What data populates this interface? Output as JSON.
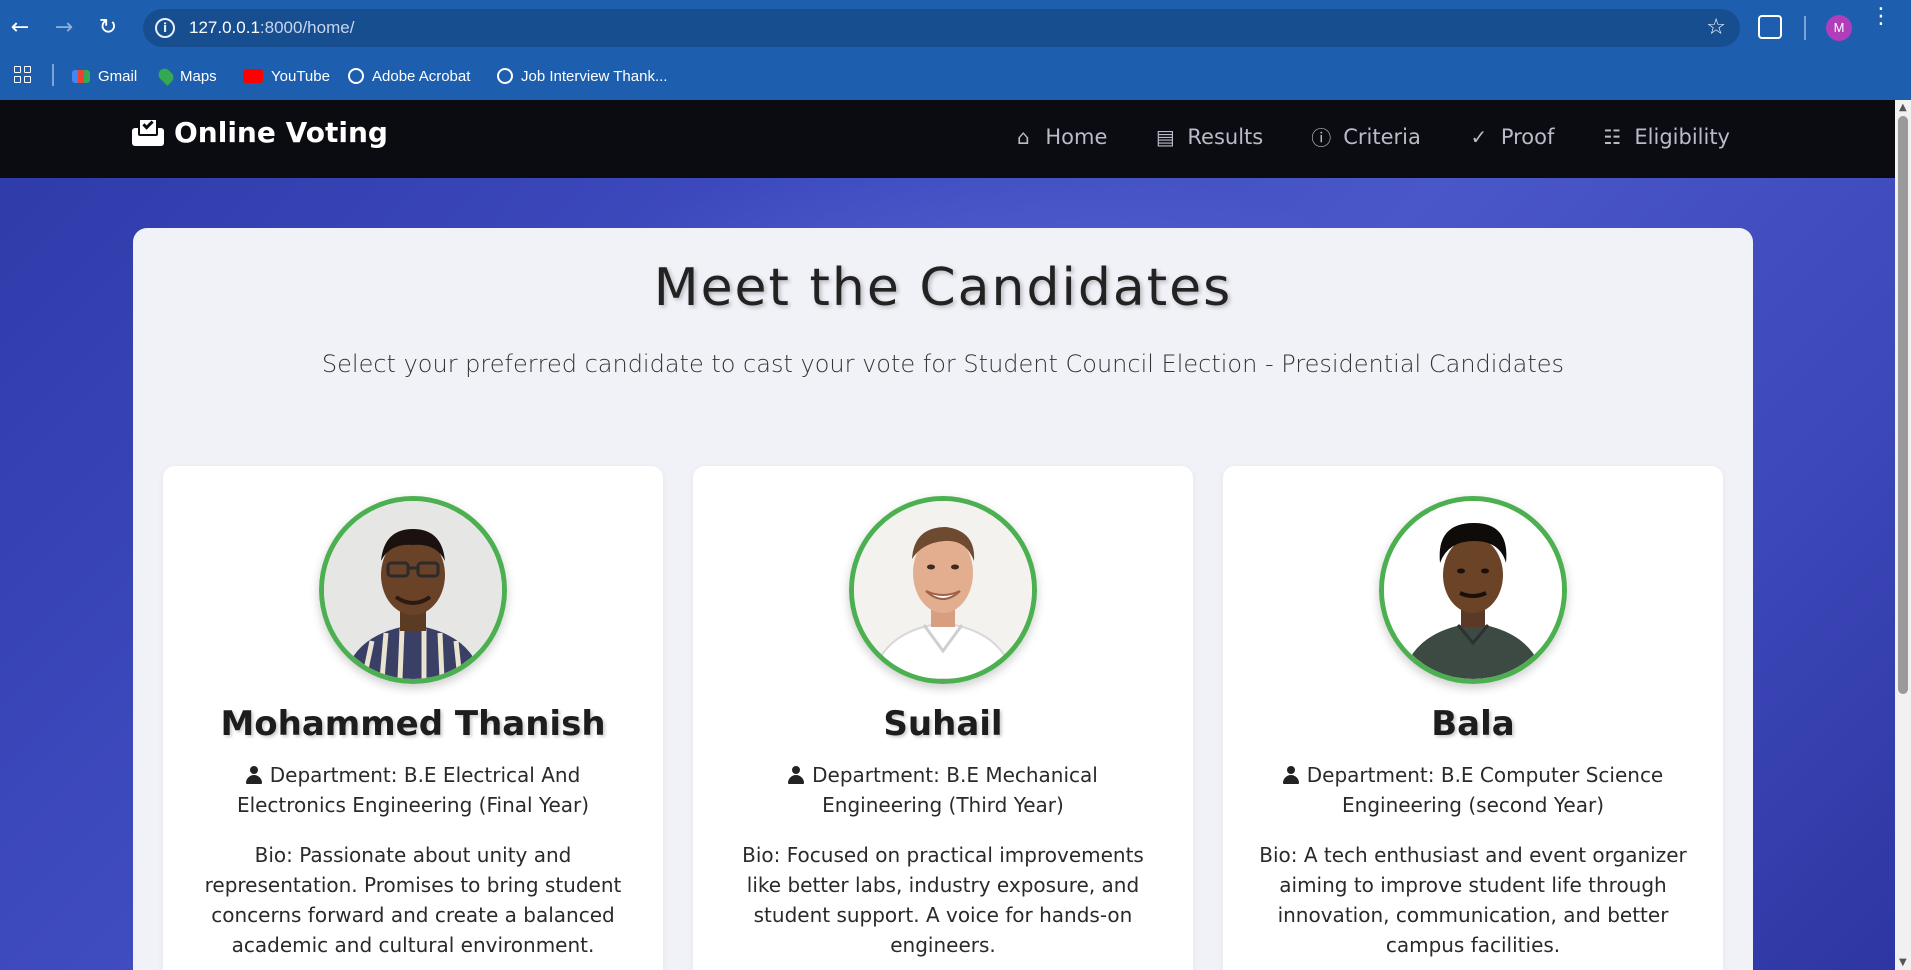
{
  "browser": {
    "url_host": "127.0.0.1",
    "url_rest": ":8000/home/",
    "profile_initial": "M",
    "bookmarks": [
      {
        "label": "Gmail",
        "color": "#ea4335"
      },
      {
        "label": "Maps",
        "color": "#34a853"
      },
      {
        "label": "YouTube",
        "color": "#ff0000"
      },
      {
        "label": "Adobe Acrobat",
        "color": "#ffffff"
      },
      {
        "label": "Job Interview Thank...",
        "color": "#ffffff"
      }
    ]
  },
  "navbar": {
    "brand": "Online Voting",
    "links": [
      {
        "label": "Home",
        "icon": "home-icon"
      },
      {
        "label": "Results",
        "icon": "bar-chart-icon"
      },
      {
        "label": "Criteria",
        "icon": "info-icon"
      },
      {
        "label": "Proof",
        "icon": "check-icon"
      },
      {
        "label": "Eligibility",
        "icon": "id-card-icon"
      }
    ]
  },
  "main": {
    "title": "Meet the Candidates",
    "subtitle": "Select your preferred candidate to cast your vote for Student Council Election - Presidential Candidates",
    "candidates": [
      {
        "name": "Mohammed Thanish",
        "department": "Department: B.E Electrical And Electronics Engineering (Final Year)",
        "bio": "Bio: Passionate about unity and representation. Promises to bring student concerns forward and create a balanced academic and cultural environment."
      },
      {
        "name": "Suhail",
        "department": "Department: B.E Mechanical Engineering (Third Year)",
        "bio": "Bio: Focused on practical improvements like better labs, industry exposure, and student support. A voice for hands-on engineers."
      },
      {
        "name": "Bala",
        "department": "Department: B.E Computer Science Engineering (second Year)",
        "bio": "Bio: A tech enthusiast and event organizer aiming to improve student life through innovation, communication, and better campus facilities."
      }
    ]
  },
  "colors": {
    "accent_border": "#4caf50",
    "navbar_bg": "#0b0b12",
    "browser_bg": "#1d5fae"
  }
}
